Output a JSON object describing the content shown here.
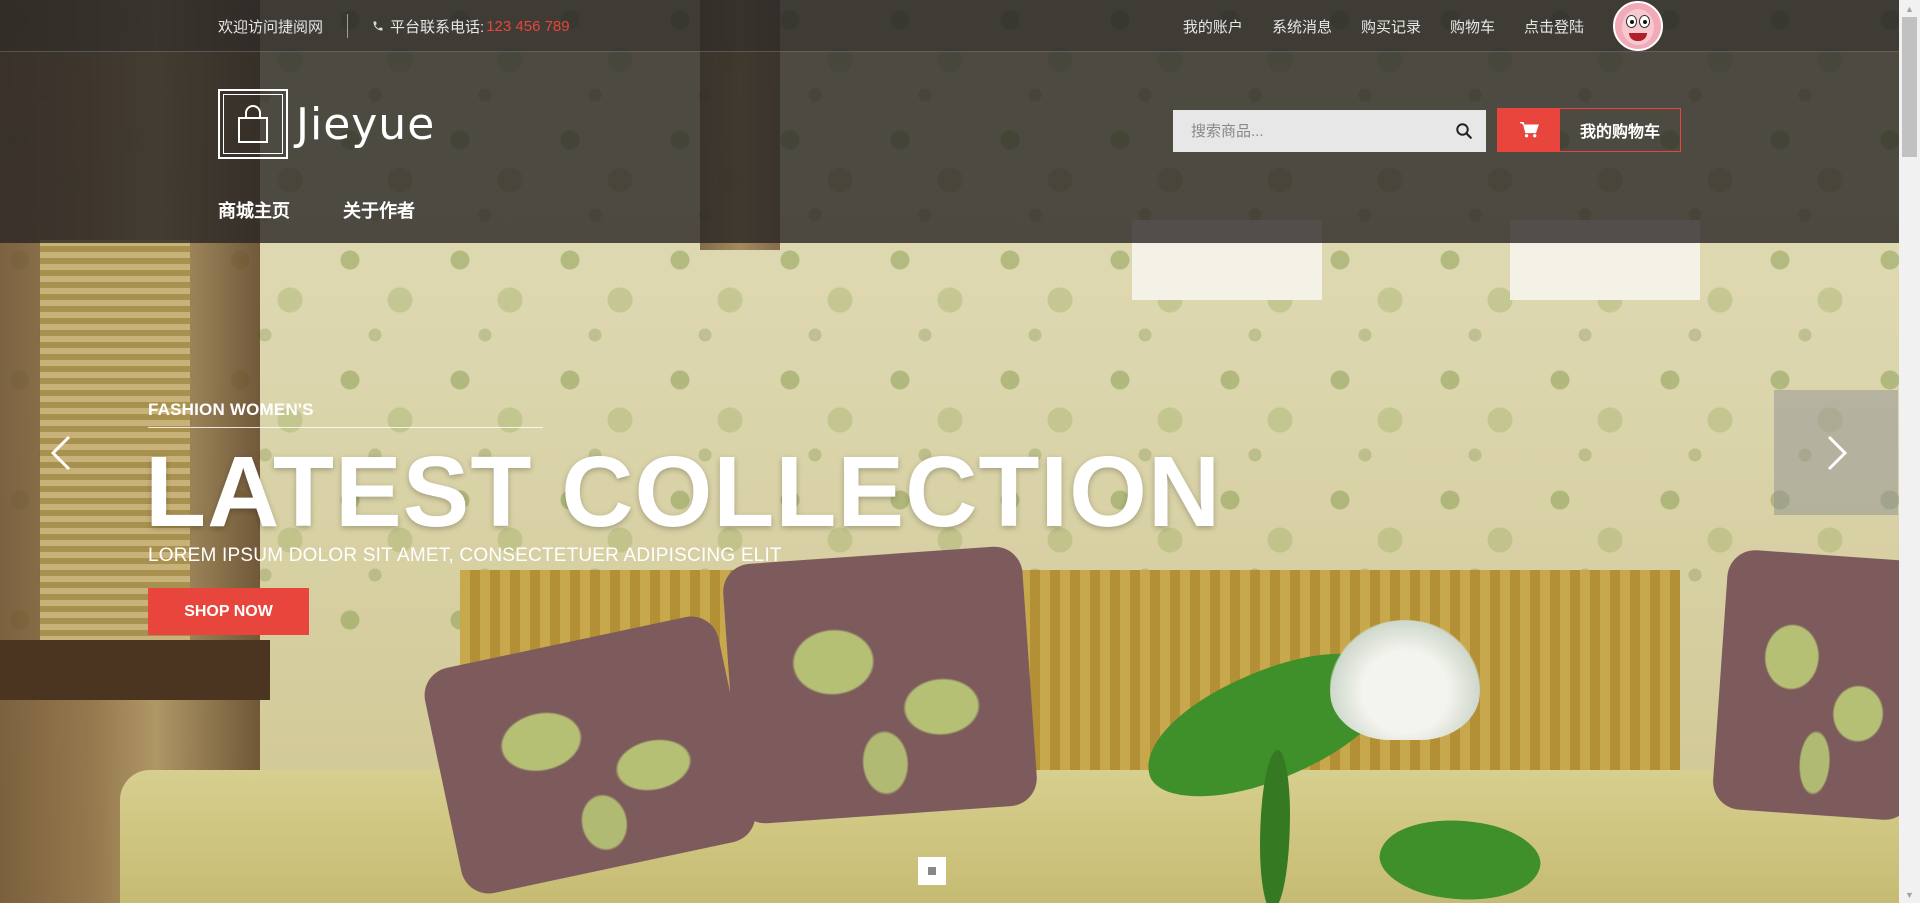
{
  "topbar": {
    "welcome": "欢迎访问捷阅网",
    "phone_label": "平台联系电话:",
    "phone_number": "123 456 789",
    "links": [
      "我的账户",
      "系统消息",
      "购买记录",
      "购物车",
      "点击登陆"
    ]
  },
  "header": {
    "logo_text": "Jieyue",
    "nav": [
      "商城主页",
      "关于作者"
    ],
    "search_placeholder": "搜索商品...",
    "cart_label": "我的购物车"
  },
  "slide": {
    "subtitle": "FASHION WOMEN'S",
    "title": "LATEST COLLECTION",
    "description": "LOREM IPSUM DOLOR SIT AMET, CONSECTETUER ADIPISCING ELIT",
    "button": "SHOP NOW",
    "dot_count": 1,
    "active_dot": 0
  },
  "colors": {
    "accent": "#e8453c",
    "bar_bg": "#282624",
    "text_light": "#ffffff"
  },
  "icons": {
    "phone": "phone-icon",
    "search": "search-icon",
    "cart": "cart-icon",
    "prev": "chevron-left-icon",
    "next": "chevron-right-icon",
    "logo": "shopping-bag-icon"
  }
}
